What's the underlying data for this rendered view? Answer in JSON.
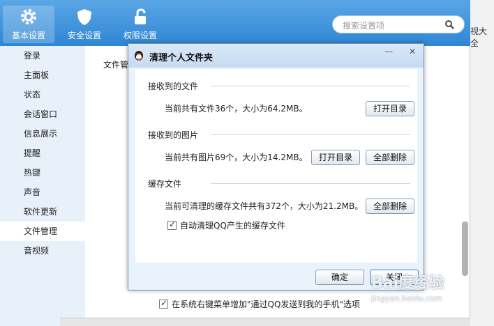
{
  "toolbar": {
    "items": [
      {
        "label": "基本设置",
        "icon": "gear-icon"
      },
      {
        "label": "安全设置",
        "icon": "shield-icon"
      },
      {
        "label": "权限设置",
        "icon": "lock-icon"
      }
    ],
    "search_placeholder": "搜索设置项"
  },
  "sidebar": {
    "items": [
      "登录",
      "主面板",
      "状态",
      "会话窗口",
      "信息展示",
      "提醒",
      "热键",
      "声音",
      "软件更新",
      "文件管理",
      "音视频"
    ],
    "active_index": 9
  },
  "content": {
    "section_label": "文件管",
    "bottom_checkbox": "在系统右键菜单增加\"通过QQ发送到我的手机\"选项"
  },
  "right_fragment": "视大全",
  "dialog": {
    "title": "清理个人文件夹",
    "minimize": "—",
    "close": "✕",
    "received_files": {
      "title": "接收到的文件",
      "info": "当前共有文件36个，大小为64.2MB。",
      "open_button": "打开目录"
    },
    "received_images": {
      "title": "接收到的图片",
      "info": "当前共有图片69个，大小为14.2MB。",
      "open_button": "打开目录",
      "delete_button": "全部删除"
    },
    "cache": {
      "title": "缓存文件",
      "info": "当前可清理的缓存文件共有372个，大小为21.2MB。",
      "delete_button": "全部删除",
      "auto_clean_label": "自动清理QQ产生的缓存文件"
    },
    "ok_button": "确定",
    "close_button": "关闭"
  },
  "watermark": {
    "logo": "Bai度经验",
    "url": "jingyan.baidu.com"
  }
}
